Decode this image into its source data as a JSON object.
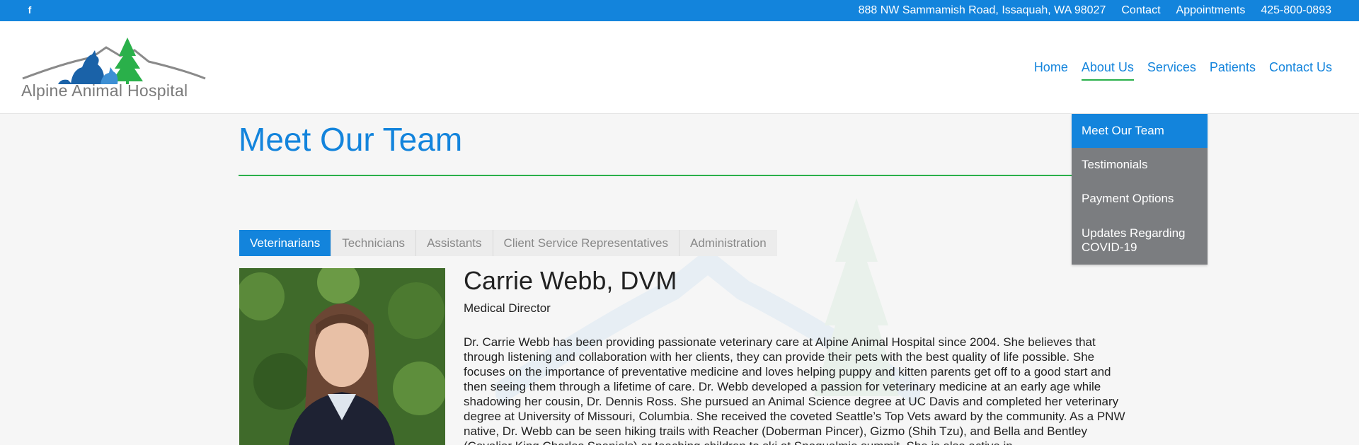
{
  "topbar": {
    "facebook_icon": "facebook-icon",
    "address": "888 NW Sammamish Road, Issaquah, WA 98027",
    "contact": "Contact",
    "appointments": "Appointments",
    "phone": "425-800-0893"
  },
  "header": {
    "logo_text": "Alpine Animal Hospital",
    "nav": {
      "home": "Home",
      "about": "About Us",
      "services": "Services",
      "patients": "Patients",
      "contact": "Contact Us"
    }
  },
  "dropdown": {
    "meet_team": "Meet Our Team",
    "testimonials": "Testimonials",
    "payment": "Payment Options",
    "covid": "Updates Regarding COVID-19"
  },
  "main": {
    "title": "Meet Our Team",
    "tabs": {
      "vets": "Veterinarians",
      "techs": "Technicians",
      "assistants": "Assistants",
      "csr": "Client Service Representatives",
      "admin": "Administration"
    },
    "person": {
      "name": "Carrie Webb, DVM",
      "role": "Medical Director",
      "bio": "Dr. Carrie Webb has been providing passionate veterinary care at Alpine Animal Hospital since 2004. She believes that through listening and collaboration with her clients, they can provide their pets with the best quality of life possible. She focuses on the importance of preventative medicine and loves helping puppy and kitten parents get off to a good start and then seeing them through a lifetime of care. Dr. Webb developed a passion for veterinary medicine at an early age while shadowing her cousin, Dr. Dennis Ross. She pursued an Animal Science degree at UC Davis and completed her veterinary degree at University of Missouri, Columbia. She received the coveted Seattle’s Top Vets award by the community. As a PNW native, Dr. Webb can be seen hiking trails with Reacher (Doberman Pincer), Gizmo (Shih Tzu), and Bella and Bentley (Cavalier King Charles Spaniels) or teaching children to ski at Snoqualmie summit. She is also active in"
    }
  },
  "colors": {
    "brand_blue": "#1384dc",
    "accent_green": "#2ab04a",
    "dropdown_gray": "#7b7d80"
  }
}
